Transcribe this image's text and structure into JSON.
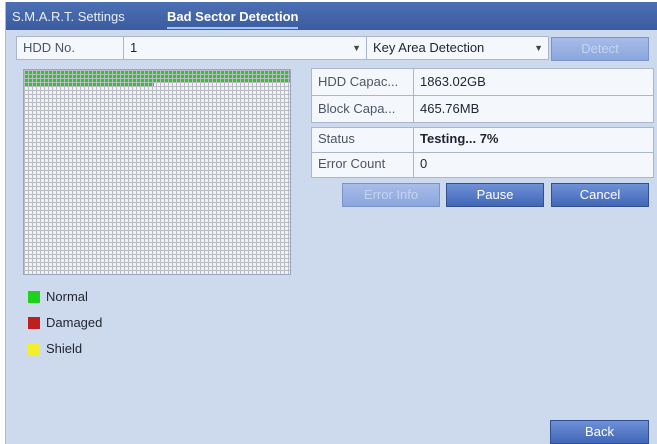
{
  "tabs": [
    {
      "label": "S.M.A.R.T. Settings"
    },
    {
      "label": "Bad Sector Detection"
    }
  ],
  "controls": {
    "hdd_label": "HDD No.",
    "hdd_value": "1",
    "mode_value": "Key Area Detection",
    "detect_button": "Detect"
  },
  "info": {
    "hdd_capacity_label": "HDD Capac...",
    "hdd_capacity_value": "1863.02GB",
    "block_capacity_label": "Block Capa...",
    "block_capacity_value": "465.76MB",
    "status_label": "Status",
    "status_value": "Testing... 7%",
    "error_count_label": "Error Count",
    "error_count_value": "0"
  },
  "progress_percent": 7,
  "buttons": {
    "error_info": "Error Info",
    "pause": "Pause",
    "cancel": "Cancel",
    "back": "Back"
  },
  "legend": [
    {
      "label": "Normal",
      "color": "#1ed21a"
    },
    {
      "label": "Damaged",
      "color": "#c01f1f"
    },
    {
      "label": "Shield",
      "color": "#f3ef2a"
    }
  ]
}
